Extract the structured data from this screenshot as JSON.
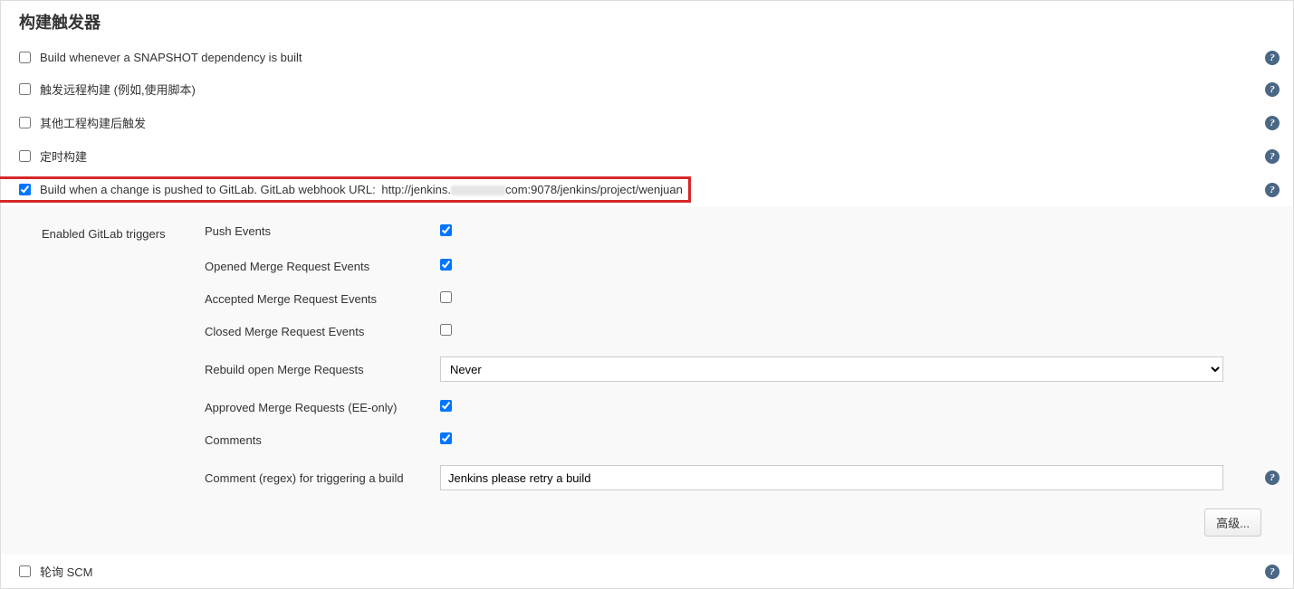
{
  "section": {
    "title": "构建触发器"
  },
  "triggers": {
    "snapshot": {
      "label": "Build whenever a SNAPSHOT dependency is built",
      "checked": false
    },
    "remote": {
      "label": "触发远程构建 (例如,使用脚本)",
      "checked": false
    },
    "after_other": {
      "label": "其他工程构建后触发",
      "checked": false
    },
    "cron": {
      "label": "定时构建",
      "checked": false
    },
    "gitlab": {
      "label_prefix": "Build when a change is pushed to GitLab. GitLab webhook URL",
      "url_prefix": "http://jenkins.",
      "url_suffix": "com:9078/jenkins/project/wenjuan",
      "checked": true
    },
    "poll_scm": {
      "label": "轮询 SCM",
      "checked": false
    }
  },
  "gitlab_panel": {
    "heading": "Enabled GitLab triggers",
    "push_events": {
      "label": "Push Events",
      "checked": true
    },
    "opened_mr": {
      "label": "Opened Merge Request Events",
      "checked": true
    },
    "accepted_mr": {
      "label": "Accepted Merge Request Events",
      "checked": false
    },
    "closed_mr": {
      "label": "Closed Merge Request Events",
      "checked": false
    },
    "rebuild_open_mr": {
      "label": "Rebuild open Merge Requests",
      "value": "Never"
    },
    "approved_mr": {
      "label": "Approved Merge Requests (EE-only)",
      "checked": true
    },
    "comments": {
      "label": "Comments",
      "checked": true
    },
    "comment_regex": {
      "label": "Comment (regex) for triggering a build",
      "value": "Jenkins please retry a build"
    },
    "advanced_btn": "高级..."
  }
}
